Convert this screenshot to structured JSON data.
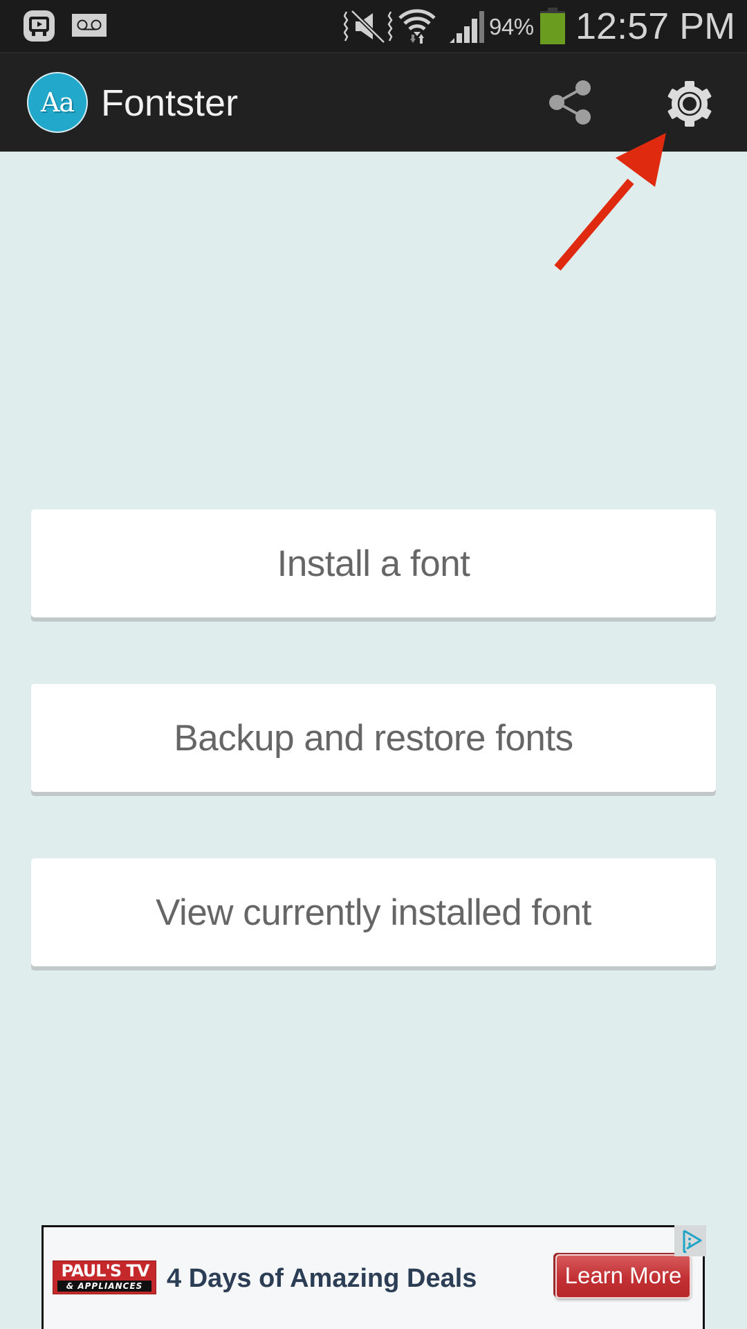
{
  "status_bar": {
    "icons": [
      "app-notification-icon",
      "voicemail-icon",
      "mute-icon",
      "wifi-icon",
      "signal-icon",
      "battery-icon"
    ],
    "battery_percent": "94%",
    "battery_level": 0.94,
    "time": "12:57 PM",
    "colors": {
      "background": "#1b1b1b",
      "icon": "#d0d0d0",
      "battery": "#6a9c1f"
    }
  },
  "action_bar": {
    "logo_text": "Aa",
    "title": "Fontster",
    "actions": [
      {
        "name": "share",
        "icon": "share-icon"
      },
      {
        "name": "settings",
        "icon": "gear-icon"
      }
    ],
    "colors": {
      "background": "#212121",
      "logo": "#22a8cb"
    }
  },
  "annotation": {
    "type": "arrow",
    "points_to": "settings",
    "color": "#e02a10"
  },
  "menu": {
    "items": [
      {
        "label": "Install a font"
      },
      {
        "label": "Backup and restore fonts"
      },
      {
        "label": "View currently installed font"
      }
    ]
  },
  "ad": {
    "brand_line1": "PAUL'S TV",
    "brand_line2": "& APPLIANCES",
    "headline": "4 Days of Amazing Deals",
    "cta": "Learn More",
    "adchoices_icon": "adchoices-icon",
    "colors": {
      "headline": "#2c3e55",
      "cta": "#c23033",
      "brand": "#c4282a"
    }
  },
  "colors": {
    "page_background": "#dfeded",
    "card_text": "#666666"
  }
}
